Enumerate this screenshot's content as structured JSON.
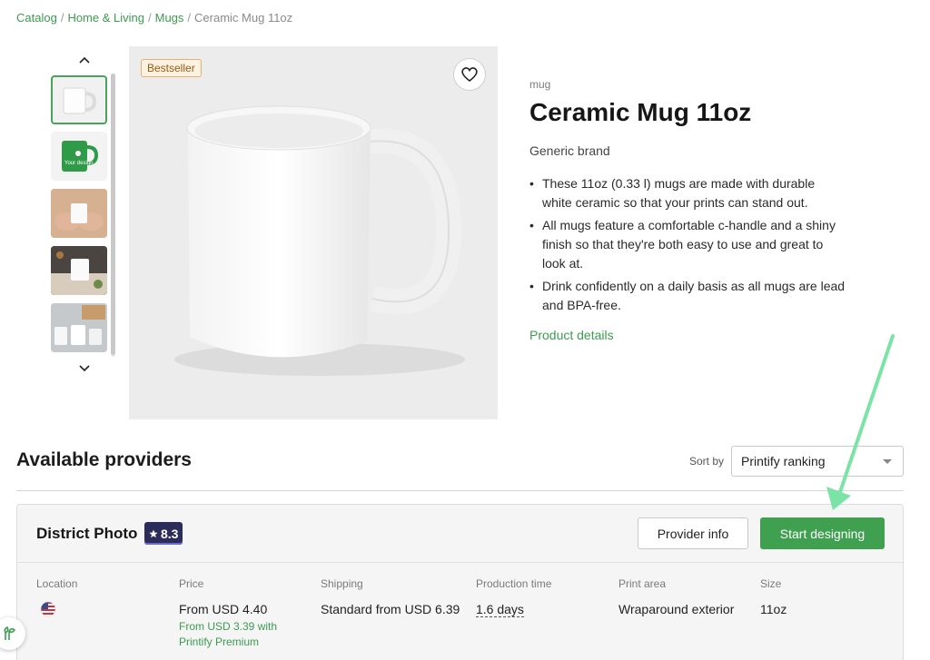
{
  "breadcrumb": {
    "items": [
      "Catalog",
      "Home & Living",
      "Mugs"
    ],
    "current": "Ceramic Mug 11oz",
    "separator": "/"
  },
  "gallery": {
    "badge": "Bestseller",
    "thumbnails": [
      "white-mug",
      "green-your-design-mug",
      "hands-holding-mug",
      "mug-on-table",
      "mug-set-desk"
    ],
    "thumb_text": "Your design"
  },
  "product": {
    "category": "mug",
    "title": "Ceramic Mug 11oz",
    "brand": "Generic brand",
    "features": [
      "These 11oz (0.33 l) mugs are made with durable white ceramic so that your prints can stand out.",
      "All mugs feature a comfortable c-handle and a shiny finish so that they're both easy to use and great to look at.",
      "Drink confidently on a daily basis as all mugs are lead and BPA-free."
    ],
    "details_link": "Product details"
  },
  "providers": {
    "title": "Available providers",
    "sort_label": "Sort by",
    "sort_value": "Printify ranking",
    "card": {
      "name": "District Photo",
      "rating": "8.3",
      "info_button": "Provider info",
      "start_button": "Start designing",
      "location": {
        "label": "Location",
        "flag": "us-flag-icon"
      },
      "price": {
        "label": "Price",
        "value": "From USD 4.40",
        "premium": "From USD 3.39 with Printify Premium"
      },
      "shipping": {
        "label": "Shipping",
        "value": "Standard from USD 6.39"
      },
      "production": {
        "label": "Production time",
        "value": "1.6 days"
      },
      "print_area": {
        "label": "Print area",
        "value": "Wraparound exterior"
      },
      "size": {
        "label": "Size",
        "value": "11oz"
      }
    }
  },
  "colors": {
    "brand_green": "#3fa050",
    "annotation_arrow": "#7ce3a6",
    "rating_bg": "#2c2c5a"
  }
}
